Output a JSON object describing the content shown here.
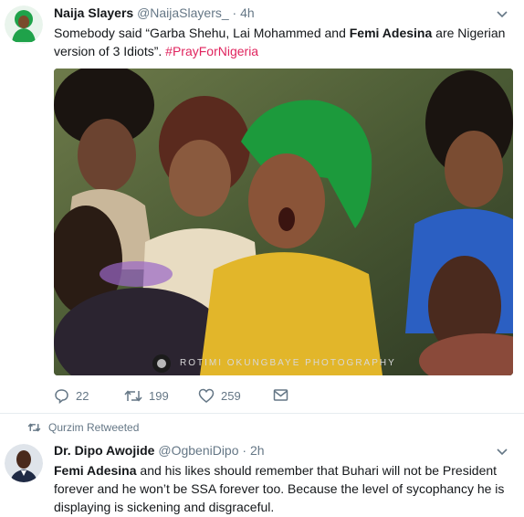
{
  "tweet1": {
    "display_name": "Naija Slayers",
    "handle": "@NaijaSlayers_",
    "separator": "·",
    "time": "4h",
    "text_before": "Somebody said “Garba Shehu, Lai Mohammed and ",
    "text_bold": "Femi Adesina",
    "text_after": " are Nigerian version of 3 Idiots”. ",
    "hashtag": "#PrayForNigeria",
    "photo_credit": "ROTIMI OKUNGBAYE PHOTOGRAPHY",
    "replies": "22",
    "retweets": "199",
    "likes": "259"
  },
  "retweet_context": {
    "label": "Qurzim Retweeted"
  },
  "tweet2": {
    "display_name": "Dr. Dipo Awojide",
    "handle": "@OgbeniDipo",
    "separator": "·",
    "time": "2h",
    "text_bold": "Femi Adesina",
    "text_after": " and his likes should remember that Buhari will not be President forever and he won’t be SSA forever too. Because the level of sycophancy he is displaying is sickening and disgraceful."
  },
  "colors": {
    "hashtag": "#e0245e",
    "secondary_text": "#657786",
    "primary_text": "#14171a"
  },
  "icons": [
    "reply-icon",
    "retweet-icon",
    "like-icon",
    "message-icon",
    "chevron-down-icon",
    "retweeted-icon"
  ]
}
